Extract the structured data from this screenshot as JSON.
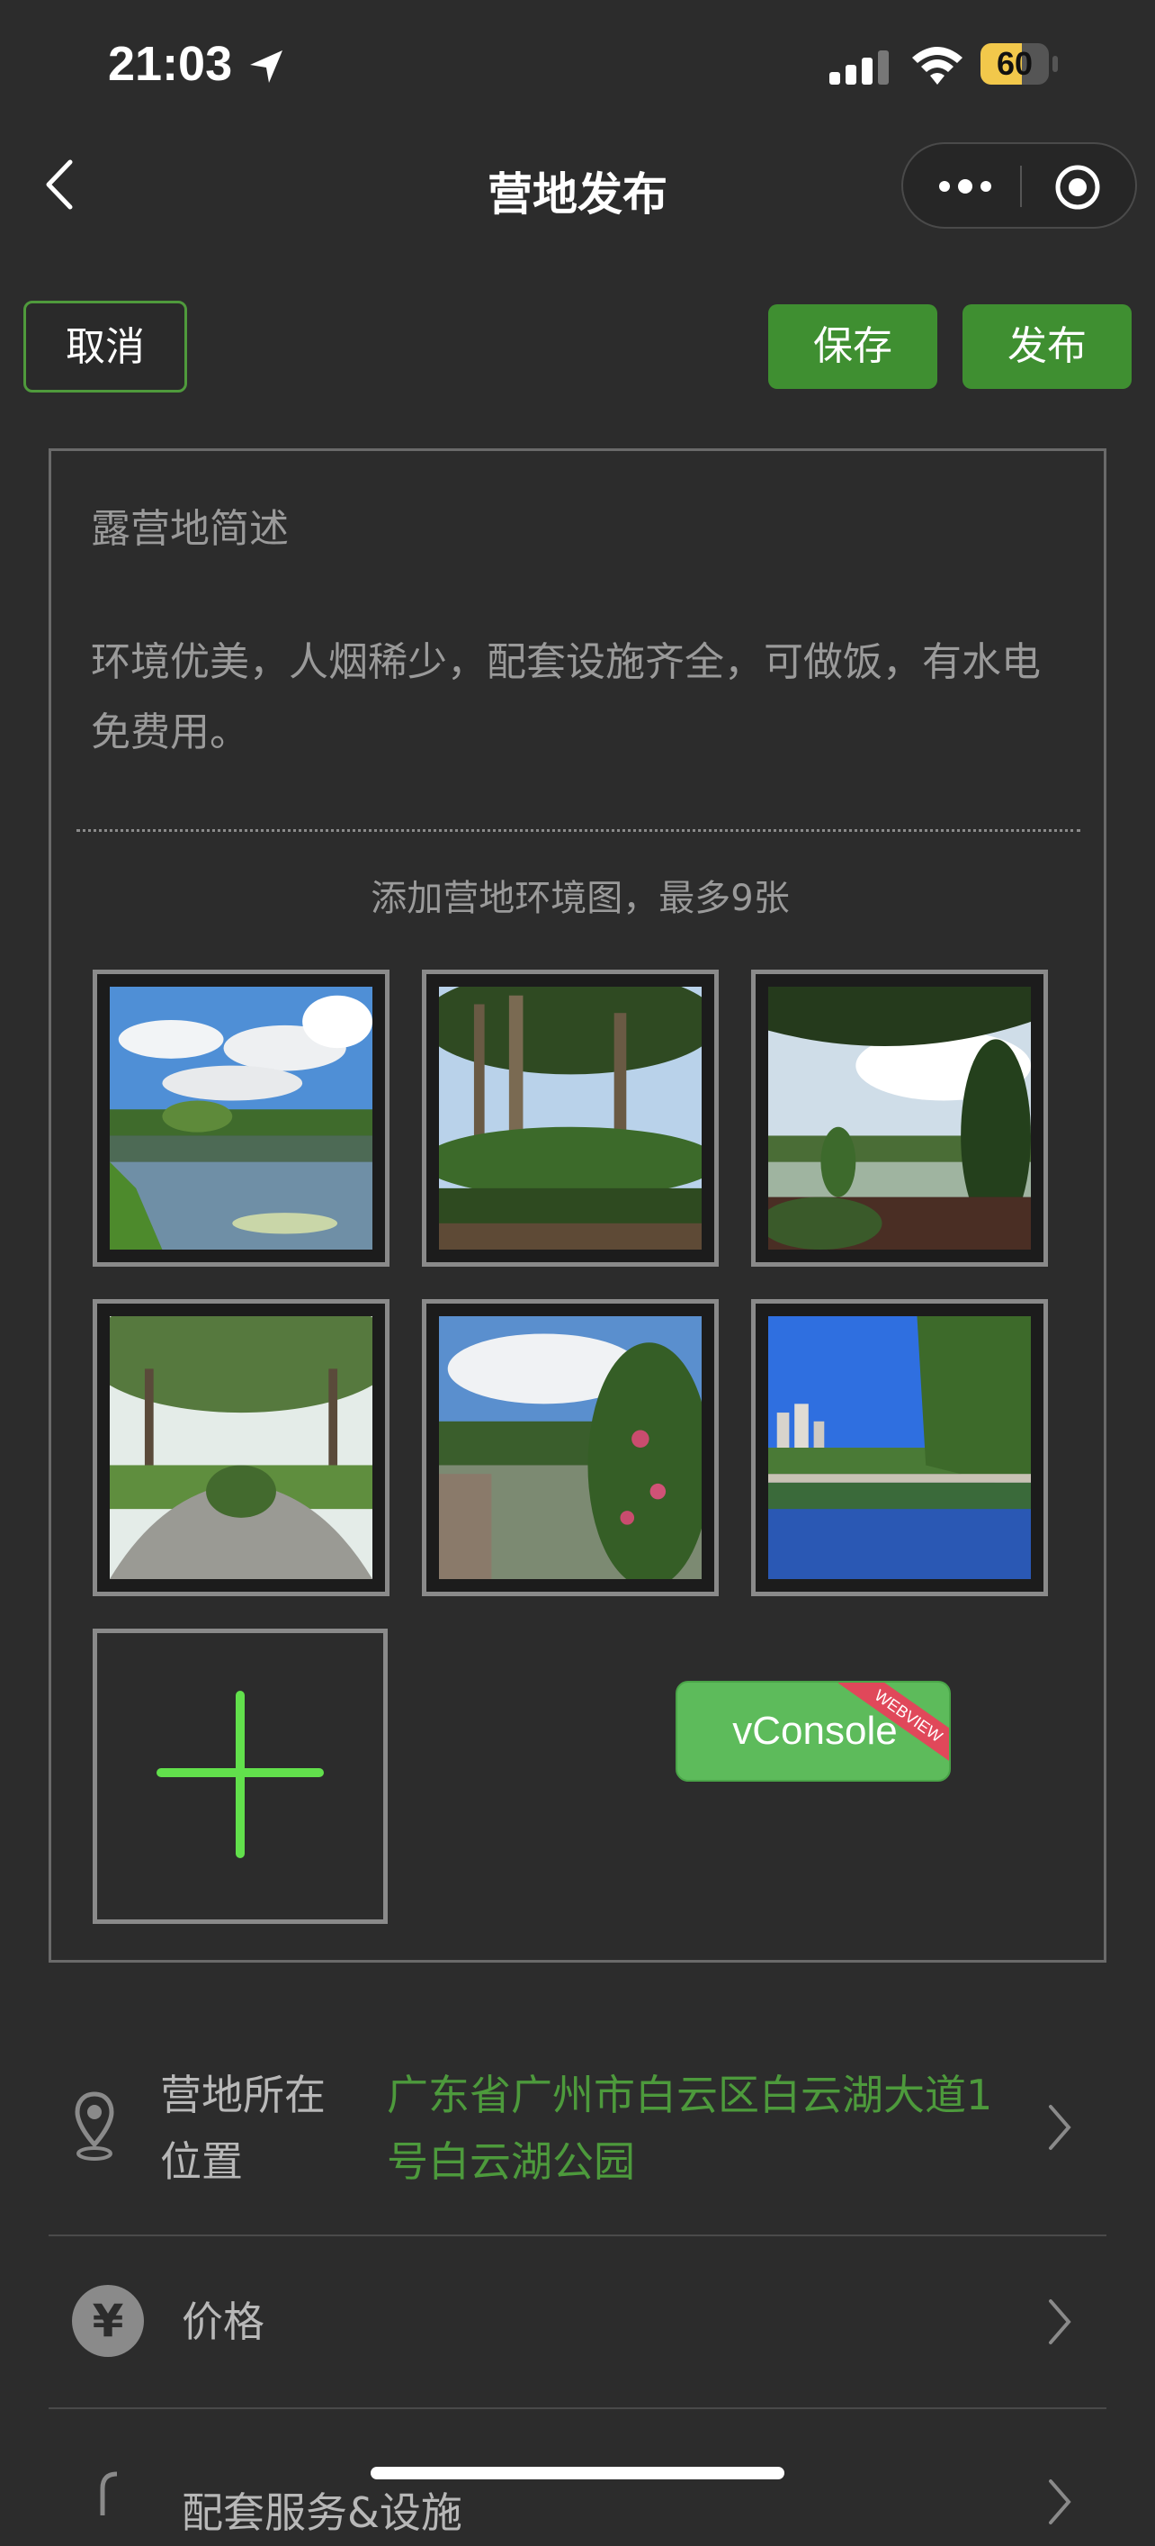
{
  "status_bar": {
    "time": "21:03",
    "battery_level": "60",
    "battery_fraction": 0.6
  },
  "nav": {
    "title": "营地发布",
    "back_icon": "chevron-left-icon",
    "more_icon": "more-dots-icon",
    "close_icon": "target-icon"
  },
  "actions": {
    "cancel": "取消",
    "save": "保存",
    "publish": "发布"
  },
  "description": {
    "title": "露营地简述",
    "body": "环境优美，人烟稀少，配套设施齐全，可做饭，有水电免费用。"
  },
  "photos": {
    "hint": "添加营地环境图，最多9张",
    "count": 6
  },
  "vconsole": {
    "label": "vConsole",
    "ribbon": "WEBVIEW"
  },
  "form": {
    "location": {
      "label_line1": "营地所在",
      "label_line2": "位置",
      "value_line1": "广东省广州市白云区白云湖大道1",
      "value_line2": "号白云湖公园"
    },
    "price": {
      "label": "价格",
      "icon_glyph": "¥"
    },
    "services": {
      "label": "配套服务&设施"
    }
  },
  "colors": {
    "background": "#2c2c2c",
    "accent_green": "#3f8f31",
    "value_green": "#4d9a3c",
    "plus_green": "#62e04c"
  }
}
